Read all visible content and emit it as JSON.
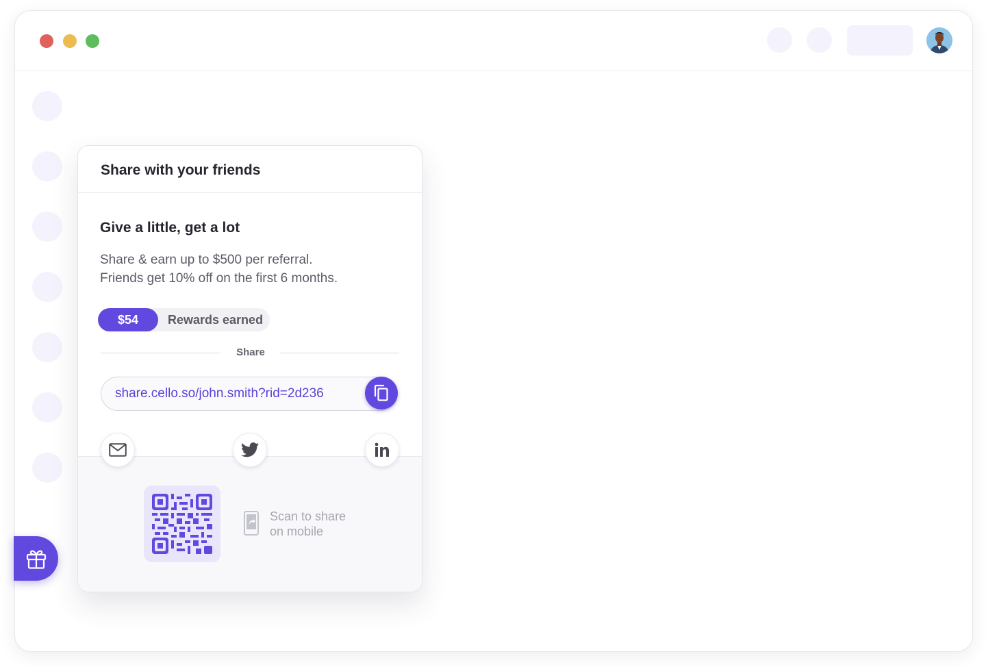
{
  "widget": {
    "title": "Share with your friends",
    "headline": "Give a little, get a lot",
    "description_line1": "Share & earn up to $500 per referral.",
    "description_line2": "Friends get 10% off on the first 6 months.",
    "rewards": {
      "amount": "$54",
      "label": "Rewards earned"
    },
    "divider_label": "Share",
    "share_link": "share.cello.so/john.smith?rid=2d236",
    "scan_line1": "Scan to share",
    "scan_line2": "on mobile"
  },
  "icons": {
    "copy": "copy-icon",
    "email": "mail-icon",
    "twitter": "twitter-icon",
    "linkedin": "linkedin-icon",
    "qr": "qr-code",
    "phone": "phone-share-icon",
    "gift": "gift-icon"
  },
  "colors": {
    "accent": "#6149e0",
    "traffic_red": "#e0615b",
    "traffic_yellow": "#ecbb52",
    "traffic_green": "#5dbd5d",
    "placeholder": "#f3f2fd"
  }
}
